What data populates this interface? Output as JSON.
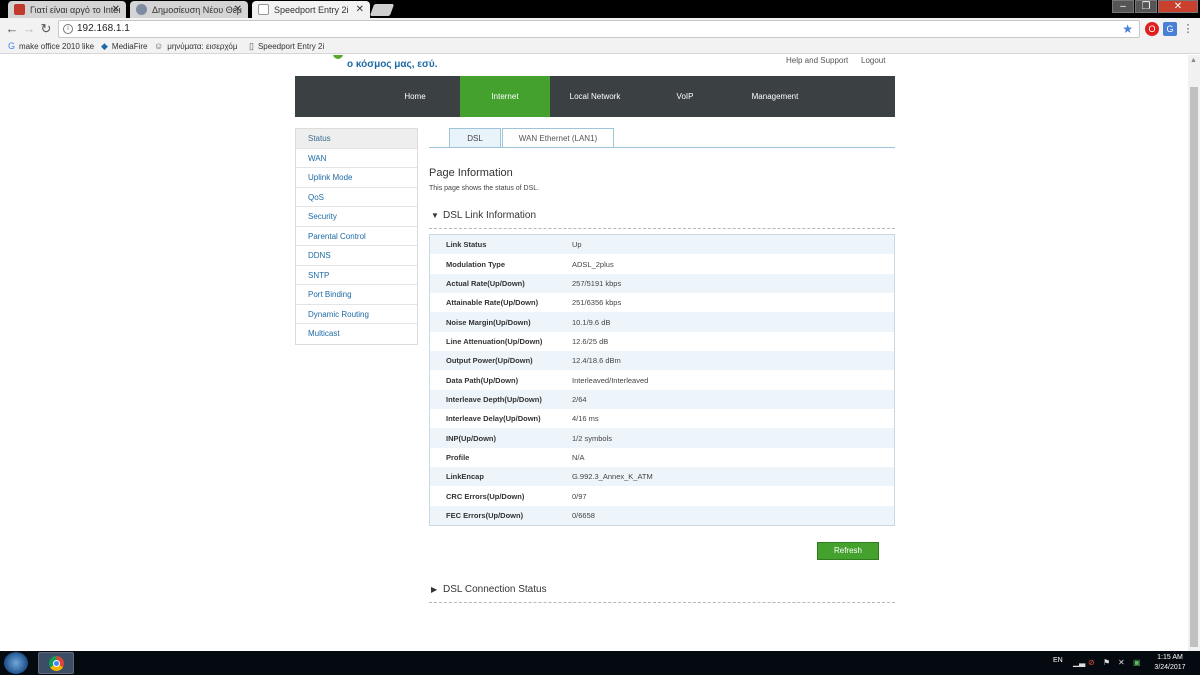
{
  "browser": {
    "tabs": [
      {
        "title": "Γιατί είναι αργό το Inter",
        "favicon_color": "#c0392b"
      },
      {
        "title": "Δημοσίευση Νέου Θέμ",
        "favicon_color": "#7d8ca3"
      },
      {
        "title": "Speedport Entry 2i",
        "favicon_color": "#ffffff"
      }
    ],
    "address": "192.168.1.1",
    "bookmarks": [
      {
        "label": "make office 2010 like",
        "icon": "G"
      },
      {
        "label": "MediaFire",
        "icon": "◆"
      },
      {
        "label": "μηνύματα: εισερχόμ",
        "icon": "☺"
      },
      {
        "label": "Speedport Entry 2i",
        "icon": "▯"
      }
    ]
  },
  "header": {
    "slogan": "ο κόσμος μας, εσύ.",
    "help_link": "Help and Support",
    "logout_link": "Logout"
  },
  "nav": {
    "items": [
      "Home",
      "Internet",
      "Local Network",
      "VoIP",
      "Management"
    ],
    "active": "Internet"
  },
  "sidebar": {
    "items": [
      "Status",
      "WAN",
      "Uplink Mode",
      "QoS",
      "Security",
      "Parental Control",
      "DDNS",
      "SNTP",
      "Port Binding",
      "Dynamic Routing",
      "Multicast"
    ],
    "active": "Status"
  },
  "subtabs": [
    "DSL",
    "WAN Ethernet (LAN1)"
  ],
  "content": {
    "page_title": "Page Information",
    "page_desc": "This page shows the status of DSL.",
    "section_link": "DSL Link Information",
    "section_conn": "DSL Connection Status",
    "refresh_label": "Refresh",
    "rows": [
      {
        "key": "Link Status",
        "value": "Up"
      },
      {
        "key": "Modulation Type",
        "value": "ADSL_2plus"
      },
      {
        "key": "Actual Rate(Up/Down)",
        "value": "257/5191 kbps"
      },
      {
        "key": "Attainable Rate(Up/Down)",
        "value": "251/6356 kbps"
      },
      {
        "key": "Noise Margin(Up/Down)",
        "value": "10.1/9.6 dB"
      },
      {
        "key": "Line Attenuation(Up/Down)",
        "value": "12.6/25 dB"
      },
      {
        "key": "Output Power(Up/Down)",
        "value": "12.4/18.6 dBm"
      },
      {
        "key": "Data Path(Up/Down)",
        "value": "Interleaved/Interleaved"
      },
      {
        "key": "Interleave Depth(Up/Down)",
        "value": "2/64"
      },
      {
        "key": "Interleave Delay(Up/Down)",
        "value": "4/16 ms"
      },
      {
        "key": "INP(Up/Down)",
        "value": "1/2 symbols"
      },
      {
        "key": "Profile",
        "value": "N/A"
      },
      {
        "key": "LinkEncap",
        "value": "G.992.3_Annex_K_ATM"
      },
      {
        "key": "CRC Errors(Up/Down)",
        "value": "0/97"
      },
      {
        "key": "FEC Errors(Up/Down)",
        "value": "0/6658"
      }
    ]
  },
  "taskbar": {
    "language": "EN",
    "time": "1:15 AM",
    "date": "3/24/2017"
  },
  "colors": {
    "accent_green": "#44a12e",
    "nav_dark": "#3b4043",
    "link_blue": "#1d6aa5"
  }
}
